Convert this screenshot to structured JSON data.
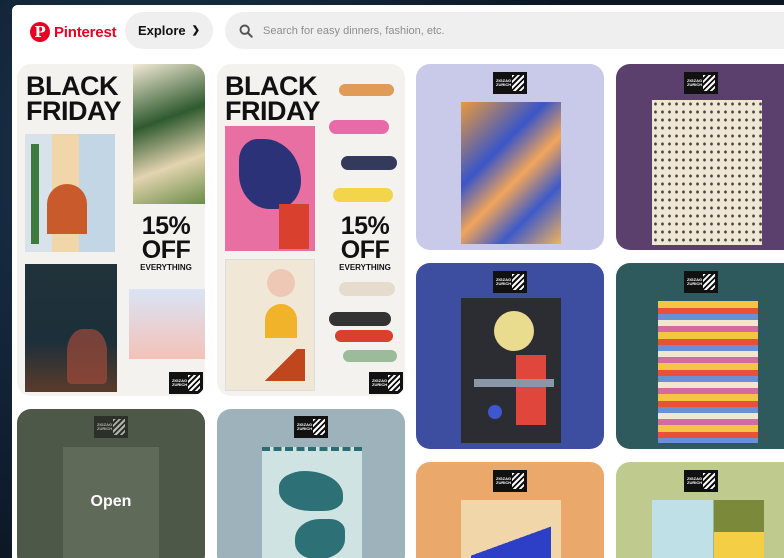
{
  "header": {
    "logo_text": "Pinterest",
    "explore_label": "Explore",
    "search_placeholder": "Search for easy dinners, fashion, etc."
  },
  "pins": {
    "promo1": {
      "title_line1": "BLACK",
      "title_line2": "FRIDAY",
      "percent": "15%",
      "off": "OFF",
      "everything": "EVERYTHING"
    },
    "promo2": {
      "title_line1": "BLACK",
      "title_line2": "FRIDAY",
      "percent": "15%",
      "off": "OFF",
      "everything": "EVERYTHING"
    },
    "hover_pin": {
      "open_label": "Open"
    }
  },
  "brand_tag": {
    "line1": "ZIGZAG",
    "line2": "ZURICH"
  },
  "colors": {
    "pinterest_red": "#e60023",
    "pin_lavender": "#c9c9ea",
    "pin_purple": "#5b3f6c",
    "pin_blue": "#3d4ea1",
    "pin_teal": "#2f5a5d",
    "pin_orange": "#eba86b",
    "pin_green": "#bfcb8e",
    "pin_olive": "#4e5848",
    "pin_slate": "#9db2bb"
  }
}
